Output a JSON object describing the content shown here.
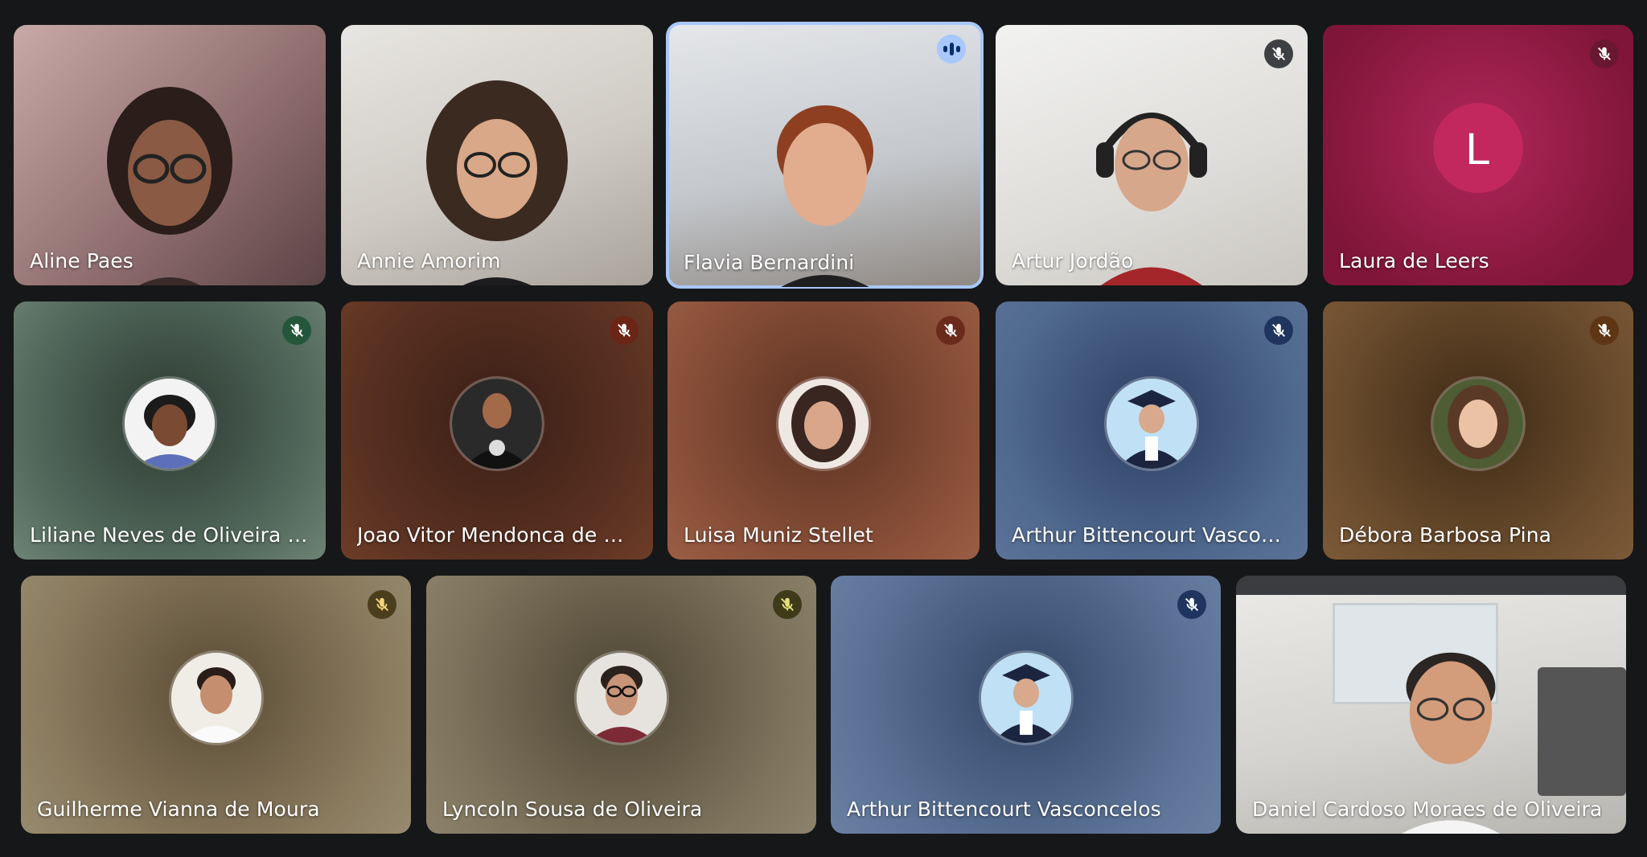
{
  "meeting": {
    "participants": [
      {
        "name": "Aline Paes",
        "type": "video",
        "mic": "none"
      },
      {
        "name": "Annie Amorim",
        "type": "video",
        "mic": "none"
      },
      {
        "name": "Flavia Bernardini",
        "type": "video",
        "mic": "speaking"
      },
      {
        "name": "Artur Jordão",
        "type": "video",
        "mic": "muted"
      },
      {
        "name": "Laura de Leers",
        "type": "letter",
        "letter": "L",
        "mic": "muted"
      },
      {
        "name": "Liliane Neves de Oliveira K...",
        "type": "avatar",
        "mic": "muted"
      },
      {
        "name": "Joao Vitor Mendonca de M...",
        "type": "avatar",
        "mic": "muted"
      },
      {
        "name": "Luisa Muniz Stellet",
        "type": "avatar",
        "mic": "muted"
      },
      {
        "name": "Arthur Bittencourt Vasconc...",
        "type": "avatar",
        "mic": "muted"
      },
      {
        "name": "Débora Barbosa Pina",
        "type": "avatar",
        "mic": "muted"
      },
      {
        "name": "Guilherme Vianna de Moura",
        "type": "avatar",
        "mic": "muted"
      },
      {
        "name": "Lyncoln Sousa de Oliveira",
        "type": "avatar",
        "mic": "muted"
      },
      {
        "name": "Arthur Bittencourt Vasconcelos",
        "type": "avatar",
        "mic": "muted"
      },
      {
        "name": "Daniel Cardoso Moraes de Oliveira",
        "type": "video",
        "mic": "none"
      }
    ]
  },
  "colors": {
    "background": "#161718",
    "speaking_outline": "#a8c7fa",
    "letter_avatar": "#c2285e"
  }
}
